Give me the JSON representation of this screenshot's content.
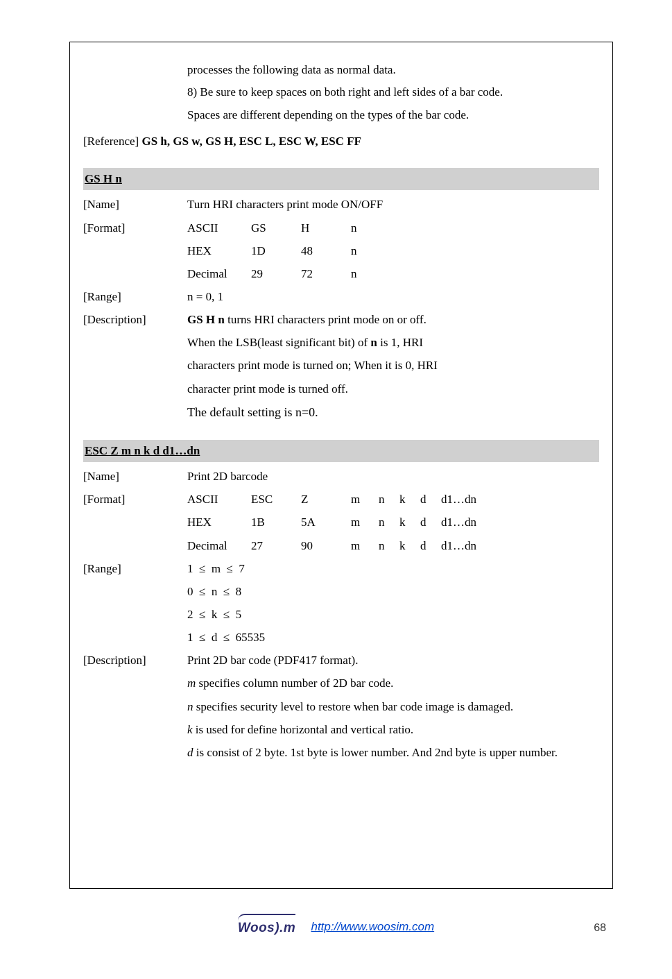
{
  "intro": {
    "line1": "processes the following data as normal data.",
    "line2": "8) Be sure to keep spaces on both right and left sides of a bar code.",
    "line3": "Spaces are different depending on the types of the bar code."
  },
  "reference": {
    "label": "[Reference] ",
    "bold": "GS h, GS w, GS H, ESC L, ESC W, ESC FF"
  },
  "sec1": {
    "heading": "GS  H  n",
    "name_lbl": "[Name]",
    "name_val": "Turn HRI characters print mode ON/OFF",
    "format_lbl": "[Format]",
    "rows": [
      {
        "a": "ASCII",
        "b": "GS",
        "c": "H",
        "d": "n"
      },
      {
        "a": "HEX",
        "b": "1D",
        "c": "48",
        "d": "n"
      },
      {
        "a": "Decimal",
        "b": "29",
        "c": "72",
        "d": "n"
      }
    ],
    "range_lbl": "[Range]",
    "range_val": "n = 0, 1",
    "desc_lbl": "[Description]",
    "desc_l1_pre": "",
    "desc_l1_bold": "GS H n",
    "desc_l1_post": " turns HRI characters print mode on or off.",
    "desc_l2_pre": "When the LSB(least significant bit) of ",
    "desc_l2_bold": "n",
    "desc_l2_post": " is 1, HRI",
    "desc_l3": "characters print mode is turned on; When it is 0, HRI",
    "desc_l4": "character print mode is turned off.",
    "desc_l5": "The default setting is n=0."
  },
  "sec2": {
    "heading": "ESC Z m n k d d1…dn",
    "name_lbl": "[Name]",
    "name_val": "Print 2D barcode",
    "format_lbl": "[Format]",
    "rows": [
      {
        "a": "ASCII",
        "b": "ESC",
        "c": "Z",
        "h": "d1…dn"
      },
      {
        "a": "HEX",
        "b": "1B",
        "c": "5A",
        "h": "d1…dn"
      },
      {
        "a": "Decimal",
        "b": "27",
        "c": "90",
        "h": "d1…dn"
      }
    ],
    "mnkd": {
      "m": "m",
      "n": "n",
      "k": "k",
      "d": "d"
    },
    "range_lbl": "[Range]",
    "range_l1": "1  ≤  m  ≤  7",
    "range_l2": "0  ≤  n  ≤  8",
    "range_l3": "2  ≤  k  ≤  5",
    "range_l4": "1  ≤  d  ≤  65535",
    "desc_lbl": "[Description]",
    "desc_l1": "Print 2D bar code (PDF417 format).",
    "desc_l2_i": "m",
    "desc_l2_post": " specifies column number of 2D bar code.",
    "desc_l3_i": "n",
    "desc_l3_post": " specifies security level to restore when bar code image is damaged.",
    "desc_l4_i": "k",
    "desc_l4_post": " is used for define horizontal and vertical ratio.",
    "desc_l5_i": "d",
    "desc_l5_post": " is consist of 2 byte. 1st byte is lower number. And 2nd byte is upper number."
  },
  "footer": {
    "logo": "Woos).m",
    "url_text": "http://www.woosim.com",
    "page": "68"
  }
}
